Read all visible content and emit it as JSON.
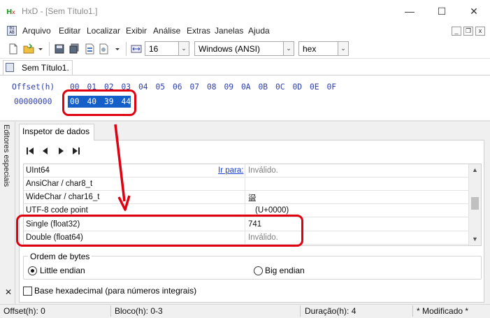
{
  "window": {
    "title": "HxD - [Sem Título1.]",
    "min_glyph": "—",
    "max_glyph": "☐",
    "close_glyph": "✕"
  },
  "menu": {
    "items": [
      "Arquivo",
      "Editar",
      "Localizar",
      "Exibir",
      "Análise",
      "Extras",
      "Janelas",
      "Ajuda"
    ],
    "mdi_min": "_",
    "mdi_restore": "❐",
    "mdi_close": "x"
  },
  "toolbar": {
    "bytes_per_row": "16",
    "charset": "Windows (ANSI)",
    "offset_base": "hex",
    "dropdown_glyph": "⌄"
  },
  "document": {
    "tab_label": "Sem Título1."
  },
  "hex_view": {
    "offset_label": "Offset(h)",
    "columns": [
      "00",
      "01",
      "02",
      "03",
      "04",
      "05",
      "06",
      "07",
      "08",
      "09",
      "0A",
      "0B",
      "0C",
      "0D",
      "0E",
      "0F"
    ],
    "row_offset": "00000000",
    "row_bytes": [
      "00",
      "40",
      "39",
      "44"
    ]
  },
  "side_panel": {
    "label": "Editores especiais",
    "close_glyph": "✕"
  },
  "inspector": {
    "tab_label": "Inspetor de dados",
    "goto_link": "Ir para:",
    "rows": [
      {
        "name": "UInt64",
        "value": "Inválido.",
        "dim": true
      },
      {
        "name": "AnsiChar / char8_t",
        "value": "",
        "dim": false
      },
      {
        "name": "WideChar / char16_t",
        "value": "䀀",
        "dim": false
      },
      {
        "name": "UTF-8 code point",
        "value": "(U+0000)",
        "dim": false
      },
      {
        "name": "Single (float32)",
        "value": "741",
        "dim": false
      },
      {
        "name": "Double (float64)",
        "value": "Inválido.",
        "dim": true
      }
    ],
    "byte_order_legend": "Ordem de bytes",
    "little_endian": "Little endian",
    "big_endian": "Big endian",
    "little_endian_selected": true,
    "hex_base_label": "Base hexadecimal (para números integrais)",
    "hex_base_checked": false
  },
  "status": {
    "offset": "Offset(h): 0",
    "block": "Bloco(h): 0-3",
    "duration": "Duração(h): 4",
    "modified": "* Modificado *"
  },
  "colors": {
    "hex_text": "#2e3fb0",
    "selection": "#1460c8",
    "annotation": "#e00010"
  }
}
